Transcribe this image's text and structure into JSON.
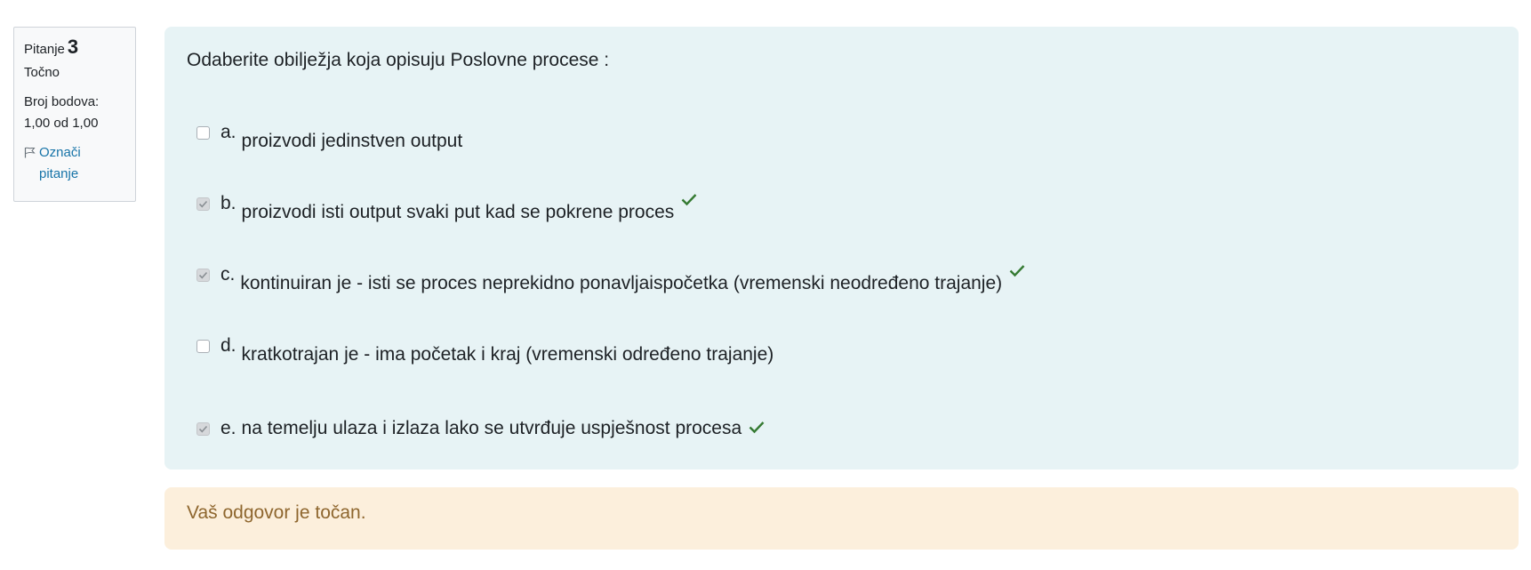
{
  "info": {
    "question_label": "Pitanje",
    "question_number": "3",
    "state": "Točno",
    "grade_label": "Broj bodova:",
    "grade_value": "1,00 od 1,00",
    "flag_label_1": "Označi",
    "flag_label_2": "pitanje"
  },
  "question": {
    "text": "Odaberite obilježja koja opisuju Poslovne procese :",
    "answers": [
      {
        "letter": "a.",
        "text": "proizvodi jedinstven output",
        "checked": false,
        "correct": false
      },
      {
        "letter": "b.",
        "text": "proizvodi isti output svaki put kad se pokrene proces",
        "checked": true,
        "correct": true
      },
      {
        "letter": "c.",
        "text": "kontinuiran je - isti se proces neprekidno ponavljaispočetka (vremenski neodređeno trajanje)",
        "checked": true,
        "correct": true
      },
      {
        "letter": "d.",
        "text": "kratkotrajan je - ima početak i kraj (vremenski određeno trajanje)",
        "checked": false,
        "correct": false
      },
      {
        "letter": "e.",
        "text": "na temelju ulaza i izlaza  lako se utvrđuje uspješnost procesa",
        "checked": true,
        "correct": true
      }
    ]
  },
  "feedback": {
    "text": "Vaš odgovor je točan."
  },
  "colors": {
    "correct_tick": "#357a32",
    "feedback_text": "#8e662e",
    "link": "#1774a8"
  }
}
